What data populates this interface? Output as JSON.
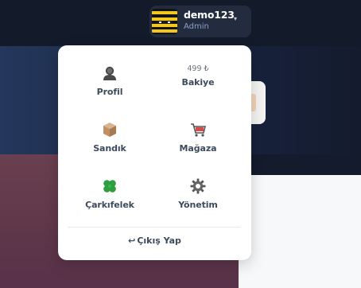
{
  "user": {
    "name": "demo123",
    "role": "Admin"
  },
  "menu": {
    "profile_label": "Profil",
    "balance_value": "499 ₺",
    "balance_label": "Bakiye",
    "chest_label": "Sandık",
    "store_label": "Mağaza",
    "wheel_label": "Çarkıfelek",
    "admin_label": "Yönetim",
    "logout_label": "Çıkış Yap"
  },
  "icons": {
    "profile": "person-silhouette-icon",
    "chest": "box-icon",
    "store": "shopping-cart-icon",
    "wheel": "four-leaf-clover-icon",
    "admin": "gear-icon",
    "logout": "return-arrow-icon",
    "chevron": "chevron-down-icon"
  },
  "colors": {
    "topbar": "#131a2a",
    "pill": "#232c3e",
    "dropdown_bg": "#ffffff",
    "label_text": "#3d4a5c",
    "role_text": "#8aa0c8"
  }
}
